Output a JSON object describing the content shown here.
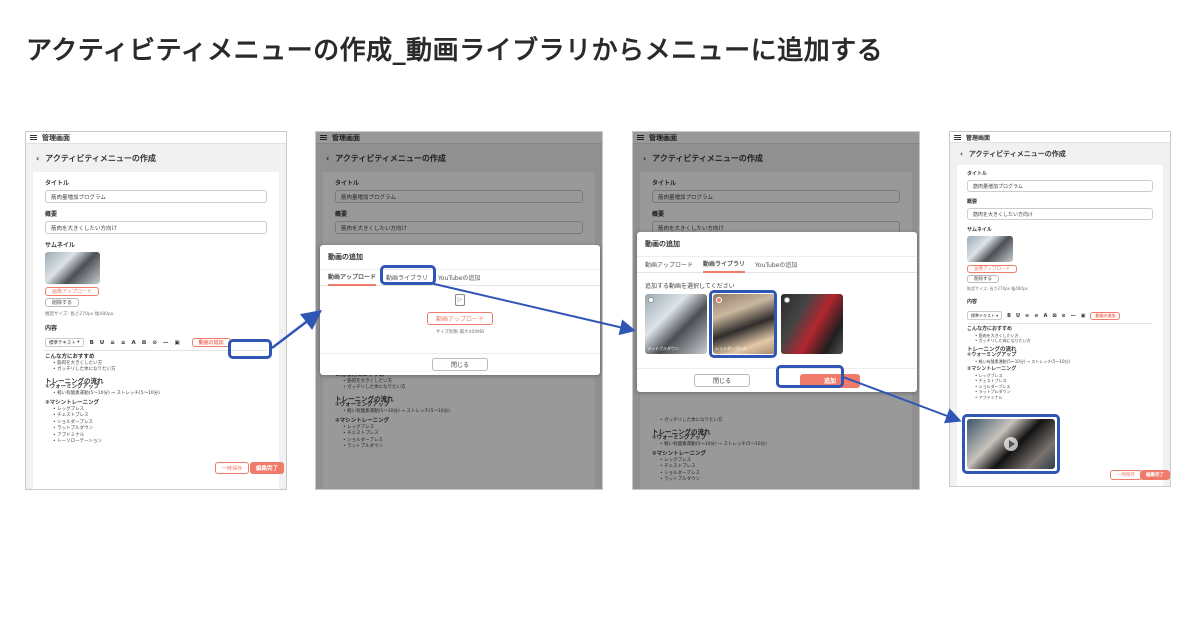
{
  "heading": "アクティビティメニューの作成_動画ライブラリからメニューに追加する",
  "colors": {
    "accent": "#f07b6b",
    "highlight": "#2f55b5"
  },
  "screen": {
    "app_title": "管理画面",
    "page_title": "アクティビティメニューの作成",
    "title_label": "タイトル",
    "title_value": "筋肉量増加プログラム",
    "summary_label": "概要",
    "summary_value": "筋肉を大きくしたい方向け",
    "thumbnail_label": "サムネイル",
    "image_upload_btn": "画像アップロード",
    "delete_btn": "削除する",
    "size_note": "推奨サイズ: 長さ270px 幅480px",
    "content_label": "内容",
    "toolbar_style": "標準テキスト",
    "toolbar_items": [
      "B",
      "U",
      "≡",
      "≡",
      "A",
      "⊠",
      "⊘",
      "—",
      "▣"
    ],
    "add_video_btn": "動画の追加",
    "editor": {
      "h1": "こんな方におすすめ",
      "h1_items": [
        "筋肉を大きくしたい方",
        "ガッチリした体になりたい方"
      ],
      "h2": "トレーニングの流れ",
      "h2_sub": "①ウォーミングアップ",
      "h2_items": [
        "軽い有酸素運動(5〜10分) → ストレッチ(5〜10分)"
      ],
      "h3": "②マシントレーニング",
      "h3_items": [
        "レッグプレス",
        "チェストプレス",
        "ショルダープレス",
        "ラットプルダウン",
        "アブドミナル",
        "トーソローテーション"
      ]
    },
    "temp_save_btn": "一時保存",
    "complete_btn": "編集完了"
  },
  "modal": {
    "title": "動画の追加",
    "tabs": [
      "動画アップロード",
      "動画ライブラリ",
      "YouTubeの追加"
    ],
    "upload_btn": "動画アップロード",
    "size_limit": "サイズ制限 最大400MB",
    "close_btn": "閉じる",
    "select_prompt": "追加する動画を選択してください",
    "add_btn": "追加",
    "video_captions": [
      "ラットプルダウン",
      "ショルダープレス"
    ]
  }
}
